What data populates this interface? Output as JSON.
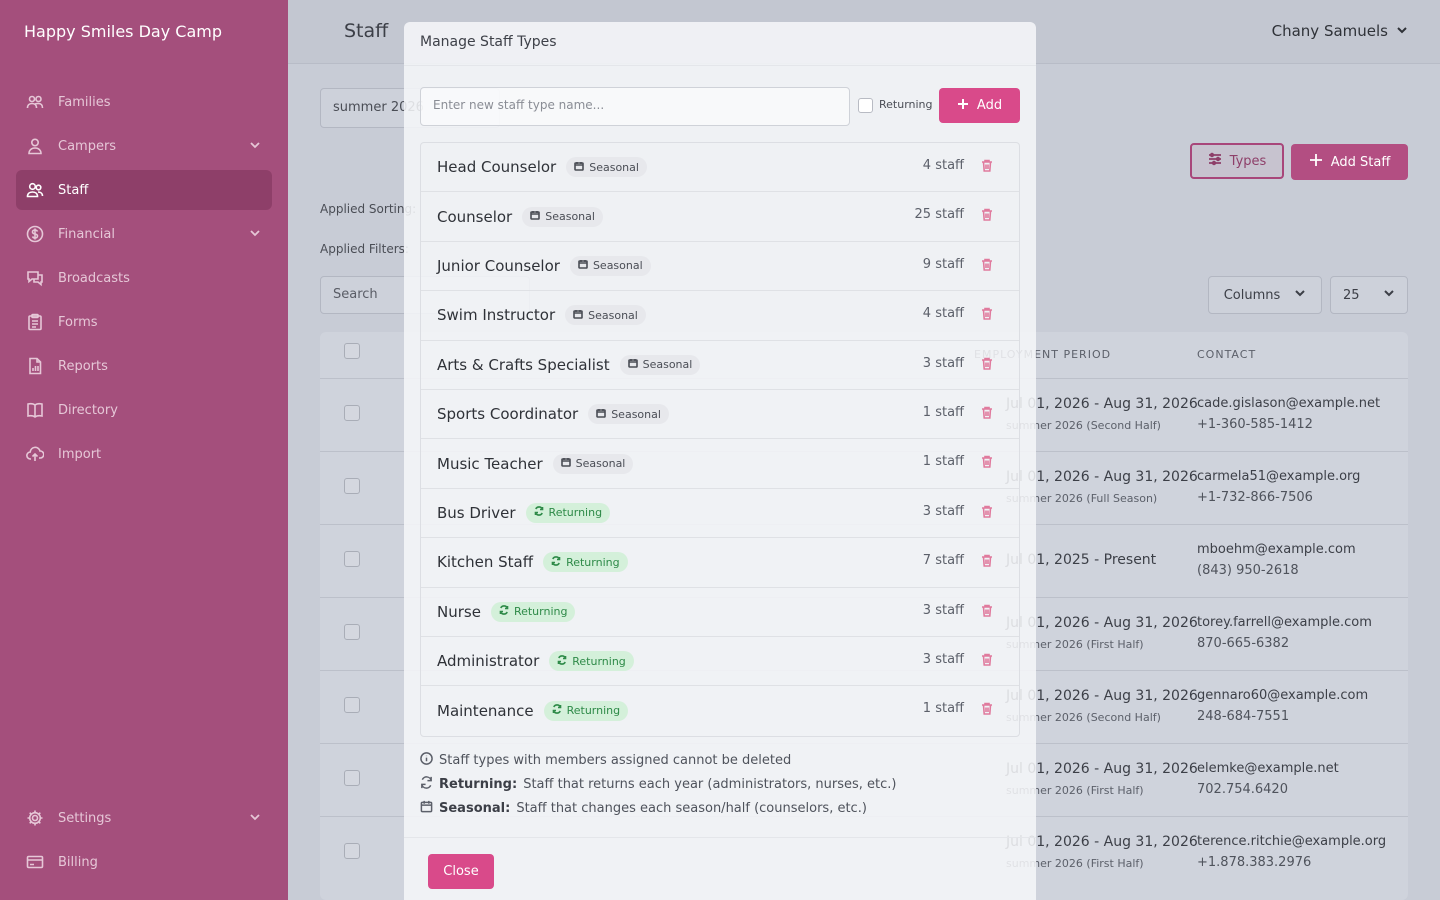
{
  "app": {
    "brand": "Happy Smiles Day Camp",
    "page_title": "Staff",
    "user": "Chany Samuels"
  },
  "sidebar": {
    "items": [
      {
        "label": "Families",
        "icon": "users-icon"
      },
      {
        "label": "Campers",
        "icon": "user-icon",
        "expandable": true
      },
      {
        "label": "Staff",
        "icon": "staff-icon",
        "active": true
      },
      {
        "label": "Financial",
        "icon": "dollar-icon",
        "expandable": true
      },
      {
        "label": "Broadcasts",
        "icon": "chat-icon"
      },
      {
        "label": "Forms",
        "icon": "clipboard-icon"
      },
      {
        "label": "Reports",
        "icon": "report-icon"
      },
      {
        "label": "Directory",
        "icon": "book-icon"
      },
      {
        "label": "Import",
        "icon": "cloud-upload-icon"
      }
    ],
    "bottom": [
      {
        "label": "Settings",
        "icon": "gear-icon",
        "expandable": true
      },
      {
        "label": "Billing",
        "icon": "card-icon"
      }
    ]
  },
  "background": {
    "season": "summer 2026",
    "types_button": "Types",
    "add_staff_button": "Add Staff",
    "applied_sorting": "Applied Sorting:",
    "applied_filters": "Applied Filters:",
    "search_placeholder": "Search",
    "columns_button": "Columns",
    "per_page": "25",
    "columns": {
      "employment": "EMPLOYMENT PERIOD",
      "contact": "CONTACT"
    },
    "rows": [
      {
        "period": "Jul 01, 2026 - Aug 31, 2026",
        "season": "summer 2026 (Second Half)",
        "email": "cade.gislason@example.net",
        "phone": "+1-360-585-1412"
      },
      {
        "period": "Jul 01, 2026 - Aug 31, 2026",
        "season": "summer 2026 (Full Season)",
        "email": "carmela51@example.org",
        "phone": "+1-732-866-7506"
      },
      {
        "period": "Jul 01, 2025 - Present",
        "season": "",
        "email": "mboehm@example.com",
        "phone": "(843) 950-2618"
      },
      {
        "period": "Jul 01, 2026 - Aug 31, 2026",
        "season": "summer 2026 (First Half)",
        "email": "torey.farrell@example.com",
        "phone": "870-665-6382"
      },
      {
        "period": "Jul 01, 2026 - Aug 31, 2026",
        "season": "summer 2026 (Second Half)",
        "email": "gennaro60@example.com",
        "phone": "248-684-7551"
      },
      {
        "period": "Jul 01, 2026 - Aug 31, 2026",
        "season": "summer 2026 (First Half)",
        "email": "elemke@example.net",
        "phone": "702.754.6420"
      },
      {
        "period": "Jul 01, 2026 - Aug 31, 2026",
        "season": "summer 2026 (First Half)",
        "email": "terence.ritchie@example.org",
        "phone": "+1.878.383.2976"
      }
    ]
  },
  "modal": {
    "title": "Manage Staff Types",
    "input_placeholder": "Enter new staff type name...",
    "returning_label": "Returning",
    "add_button": "Add",
    "types": [
      {
        "name": "Head Counselor",
        "badge": "Seasonal",
        "count": "4 staff"
      },
      {
        "name": "Counselor",
        "badge": "Seasonal",
        "count": "25 staff"
      },
      {
        "name": "Junior Counselor",
        "badge": "Seasonal",
        "count": "9 staff"
      },
      {
        "name": "Swim Instructor",
        "badge": "Seasonal",
        "count": "4 staff"
      },
      {
        "name": "Arts & Crafts Specialist",
        "badge": "Seasonal",
        "count": "3 staff"
      },
      {
        "name": "Sports Coordinator",
        "badge": "Seasonal",
        "count": "1 staff"
      },
      {
        "name": "Music Teacher",
        "badge": "Seasonal",
        "count": "1 staff"
      },
      {
        "name": "Bus Driver",
        "badge": "Returning",
        "count": "3 staff"
      },
      {
        "name": "Kitchen Staff",
        "badge": "Returning",
        "count": "7 staff"
      },
      {
        "name": "Nurse",
        "badge": "Returning",
        "count": "3 staff"
      },
      {
        "name": "Administrator",
        "badge": "Returning",
        "count": "3 staff"
      },
      {
        "name": "Maintenance",
        "badge": "Returning",
        "count": "1 staff"
      }
    ],
    "notes": {
      "delete_note": "Staff types with members assigned cannot be deleted",
      "returning_title": "Returning:",
      "returning_text": "Staff that returns each year (administrators, nurses, etc.)",
      "seasonal_title": "Seasonal:",
      "seasonal_text": "Staff that changes each season/half (counselors, etc.)"
    },
    "close_button": "Close"
  },
  "colors": {
    "sidebar": "#a44f7c",
    "accent": "#d94a8a",
    "returning": "#2e8a48"
  }
}
